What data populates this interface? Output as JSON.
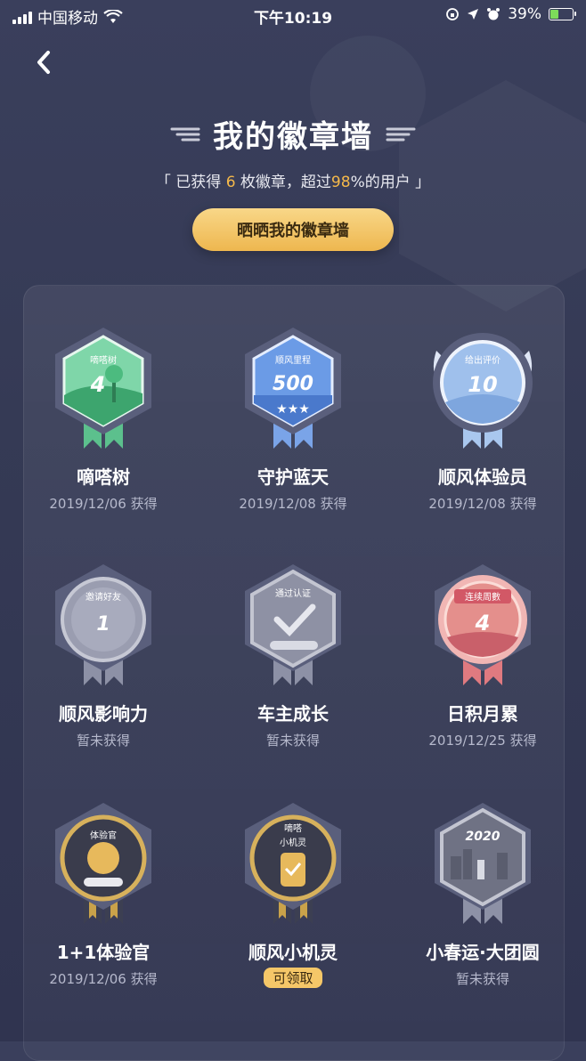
{
  "status_bar": {
    "carrier": "中国移动",
    "time": "下午10:19",
    "battery": "39%"
  },
  "header": {
    "title": "我的徽章墙",
    "subtitle_prefix": "「 已获得 ",
    "subtitle_count": "6",
    "subtitle_mid": " 枚徽章，超过",
    "subtitle_percent": "98",
    "subtitle_suffix": "%的用户 」",
    "show_button": "晒晒我的徽章墙"
  },
  "colors": {
    "accent": "#f5b94a",
    "background": "#363b57"
  },
  "badges": [
    {
      "name": "嘀嗒树",
      "date": "2019/12/06 获得",
      "label": "嘀嗒树",
      "value": "4"
    },
    {
      "name": "守护蓝天",
      "date": "2019/12/08 获得",
      "label": "顺风里程",
      "value": "500"
    },
    {
      "name": "顺风体验员",
      "date": "2019/12/08 获得",
      "label": "给出评价",
      "value": "10"
    },
    {
      "name": "顺风影响力",
      "date": "暂未获得",
      "label": "邀请好友",
      "value": "1"
    },
    {
      "name": "车主成长",
      "date": "暂未获得",
      "label": "通过认证",
      "value": ""
    },
    {
      "name": "日积月累",
      "date": "2019/12/25 获得",
      "label": "连续周數",
      "value": "4"
    },
    {
      "name": "1+1体验官",
      "date": "2019/12/06 获得",
      "label": "体验官",
      "value": ""
    },
    {
      "name": "顺风小机灵",
      "date": "",
      "claim": "可领取",
      "label": "嘀嗒",
      "label2": "小机灵",
      "value": ""
    },
    {
      "name": "小春运·大团圆",
      "date": "暂未获得",
      "label": "",
      "value": "2020"
    }
  ]
}
